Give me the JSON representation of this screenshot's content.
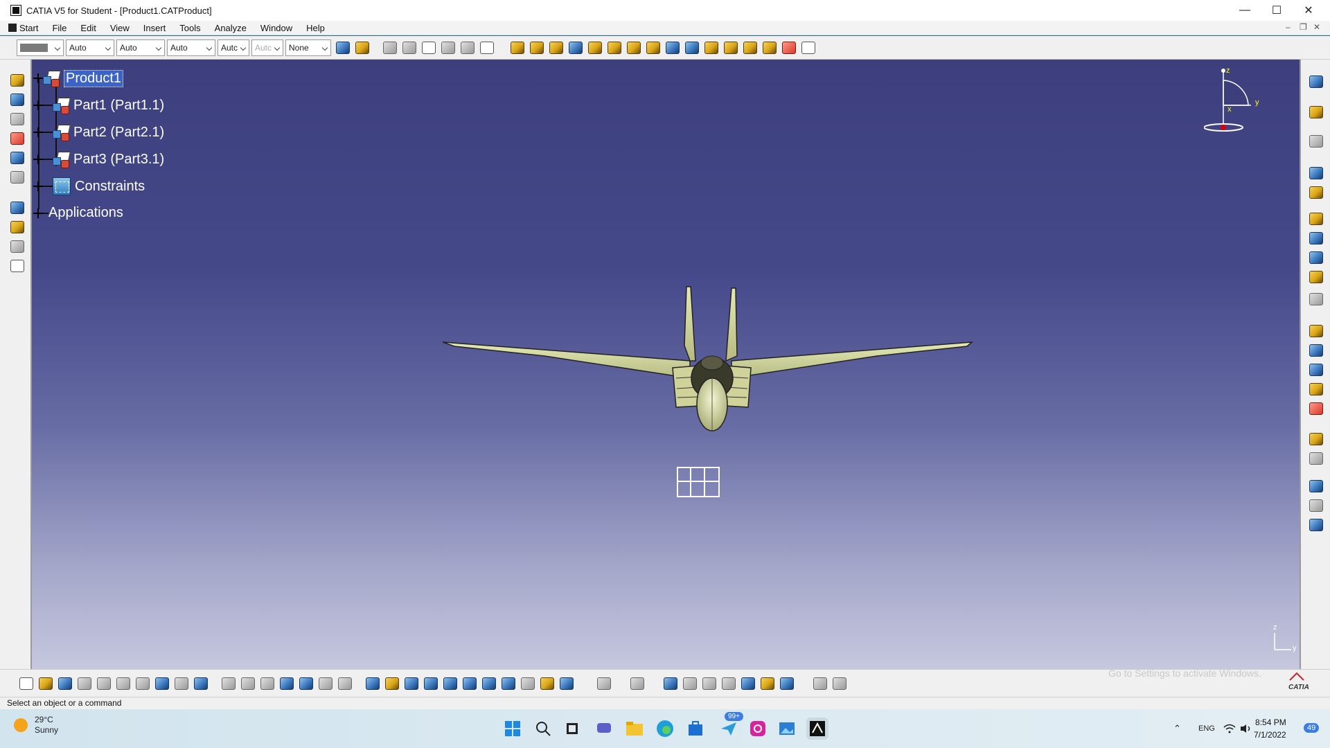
{
  "window": {
    "title": "CATIA V5 for Student - [Product1.CATProduct]",
    "minimize_icon": "minimize-icon",
    "maximize_icon": "maximize-icon",
    "close_icon": "close-icon"
  },
  "menu": {
    "items": [
      "Start",
      "File",
      "Edit",
      "View",
      "Insert",
      "Tools",
      "Analyze",
      "Window",
      "Help"
    ]
  },
  "toolbar": {
    "combos": [
      "Auto",
      "Auto",
      "Auto",
      "Autc",
      "Autc",
      "None"
    ]
  },
  "tree": {
    "root": "Product1",
    "nodes": [
      "Part1 (Part1.1)",
      "Part2 (Part2.1)",
      "Part3 (Part3.1)",
      "Constraints",
      "Applications"
    ]
  },
  "compass": {
    "x_label": "x",
    "y_label": "y",
    "z_label": "z"
  },
  "axis_corner": {
    "z_label": "z",
    "y_label": "y"
  },
  "watermark": "Go to Settings to activate Windows.",
  "status": {
    "message": "Select an object or a command"
  },
  "catia_logo": "CATIA",
  "taskbar": {
    "temperature": "29°C",
    "condition": "Sunny",
    "time": "8:54 PM",
    "date": "7/1/2022",
    "notif_count": "99+",
    "tray_count": "49",
    "lang": "ENG"
  },
  "colors": {
    "viewport_top": "#3d3f7d",
    "viewport_bottom": "#c6c8df",
    "selection": "#3b63c8",
    "aircraft": "#d8dca0"
  }
}
